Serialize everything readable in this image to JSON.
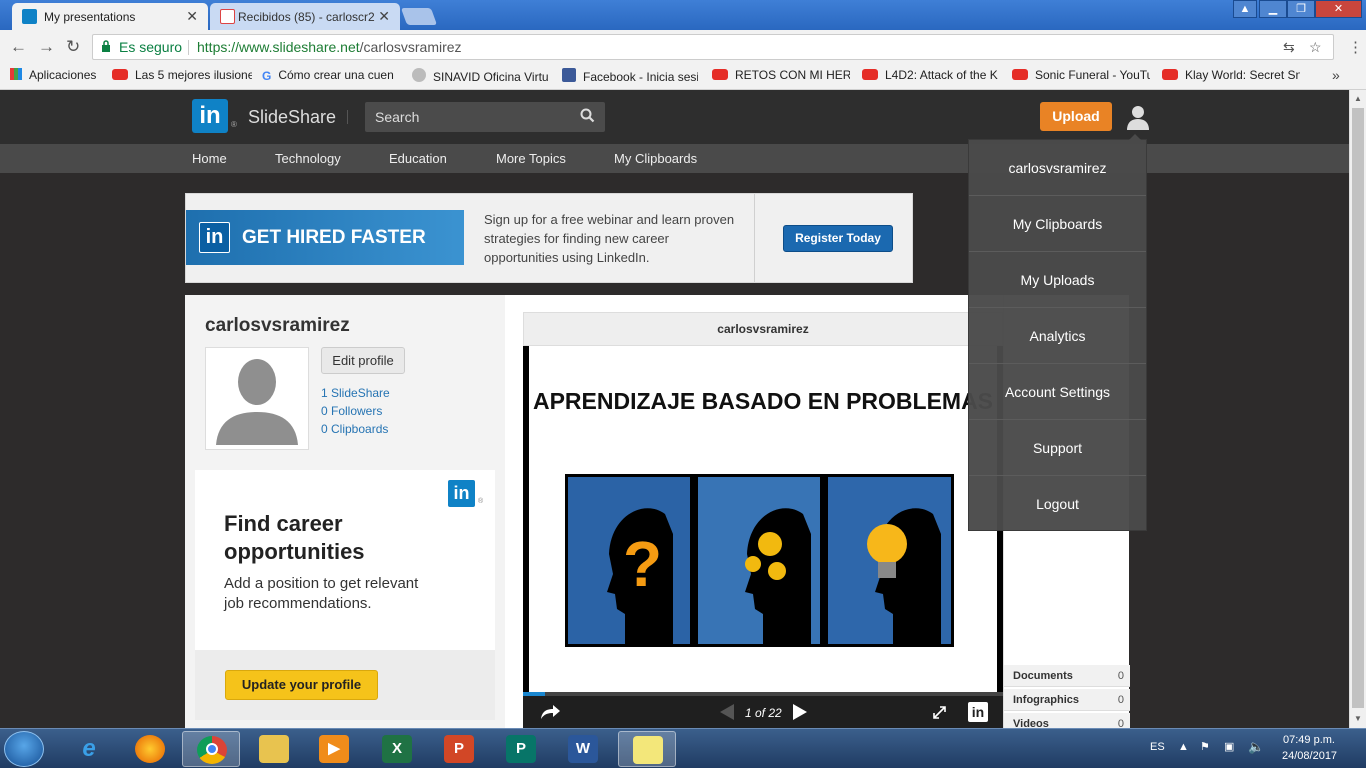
{
  "browser": {
    "tabs": [
      {
        "title": "My presentations",
        "active": true
      },
      {
        "title": "Recibidos (85) - carloscr2",
        "active": false
      }
    ],
    "address": {
      "secure_label": "Es seguro",
      "url_scheme_host": "https://www.slideshare.net",
      "url_path": "/carlosvsramirez"
    },
    "bookmarks": [
      "Aplicaciones",
      "Las 5 mejores ilusione",
      "Cómo crear una cuen",
      "SINAVID Oficina Virtu",
      "Facebook - Inicia sesi",
      "RETOS CON MI HERM",
      "L4D2: Attack of the K",
      "Sonic Funeral - YouTu",
      "Klay World: Secret Sn"
    ]
  },
  "header": {
    "brand": "SlideShare",
    "logo_text": "in",
    "search_placeholder": "Search",
    "upload_label": "Upload"
  },
  "nav": [
    "Home",
    "Technology",
    "Education",
    "More Topics",
    "My Clipboards"
  ],
  "ad": {
    "headline": "GET HIRED FASTER",
    "body": "Sign up for a free webinar and learn proven strategies for finding new career opportunities using LinkedIn.",
    "button": "Register Today"
  },
  "profile": {
    "username": "carlosvsramirez",
    "edit_label": "Edit profile",
    "stats": [
      "1 SlideShare",
      "0 Followers",
      "0 Clipboards"
    ]
  },
  "career": {
    "heading": "Find career opportunities",
    "body": "Add a position to get relevant job recommendations.",
    "button": "Update your profile"
  },
  "viewer": {
    "owner": "carlosvsramirez",
    "slide_title": "APRENDIZAJE BASADO EN PROBLEMAS",
    "page_indicator": "1 of 22",
    "progress": 0.045
  },
  "sidebar_stats": [
    {
      "label": "Documents",
      "value": "0"
    },
    {
      "label": "Infographics",
      "value": "0"
    },
    {
      "label": "Videos",
      "value": "0"
    }
  ],
  "dropdown": [
    "carlosvsramirez",
    "My Clipboards",
    "My Uploads",
    "Analytics",
    "Account Settings",
    "Support",
    "Logout"
  ],
  "taskbar": {
    "language": "ES",
    "time": "07:49 p.m.",
    "date": "24/08/2017"
  },
  "colors": {
    "upload": "#e98325",
    "linkedin": "#0f82c6",
    "link": "#2674b3",
    "update_button": "#f5c31a"
  }
}
